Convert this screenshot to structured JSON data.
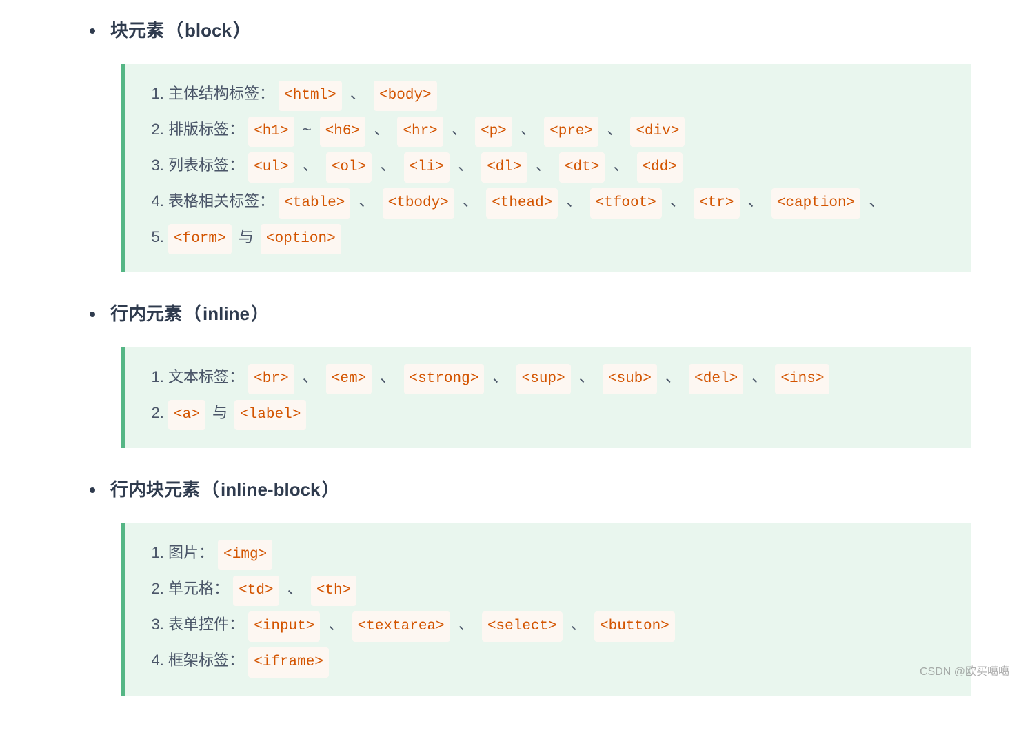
{
  "sep": "、",
  "tilde": "~",
  "and_word": "与",
  "sections": [
    {
      "heading_cn": "块元素",
      "heading_en": "block",
      "items": [
        {
          "label": "主体结构标签：",
          "tags": [
            "<html>",
            "<body>"
          ]
        },
        {
          "label": "排版标签：",
          "tags_range": [
            "<h1>",
            "<h6>"
          ],
          "tags_after": [
            "<hr>",
            "<p>",
            "<pre>",
            "<div>"
          ]
        },
        {
          "label": "列表标签：",
          "tags": [
            "<ul>",
            "<ol>",
            "<li>",
            "<dl>",
            "<dt>",
            "<dd>"
          ]
        },
        {
          "label": "表格相关标签：",
          "tags": [
            "<table>",
            "<tbody>",
            "<thead>",
            "<tfoot>",
            "<tr>",
            "<caption>"
          ]
        },
        {
          "label": "",
          "tags_and": [
            "<form>",
            "<option>"
          ]
        }
      ]
    },
    {
      "heading_cn": "行内元素",
      "heading_en": "inline",
      "items": [
        {
          "label": "文本标签：",
          "tags": [
            "<br>",
            "<em>",
            "<strong>",
            "<sup>",
            "<sub>",
            "<del>",
            "<ins>"
          ]
        },
        {
          "label": "",
          "tags_and": [
            "<a>",
            "<label>"
          ]
        }
      ]
    },
    {
      "heading_cn": "行内块元素",
      "heading_en": "inline-block",
      "items": [
        {
          "label": "图片：",
          "tags": [
            "<img>"
          ]
        },
        {
          "label": "单元格：",
          "tags": [
            "<td>",
            "<th>"
          ]
        },
        {
          "label": "表单控件：",
          "tags": [
            "<input>",
            "<textarea>",
            "<select>",
            "<button>"
          ]
        },
        {
          "label": "框架标签：",
          "tags": [
            "<iframe>"
          ]
        }
      ]
    }
  ],
  "watermark": "CSDN @欧买噶噶"
}
